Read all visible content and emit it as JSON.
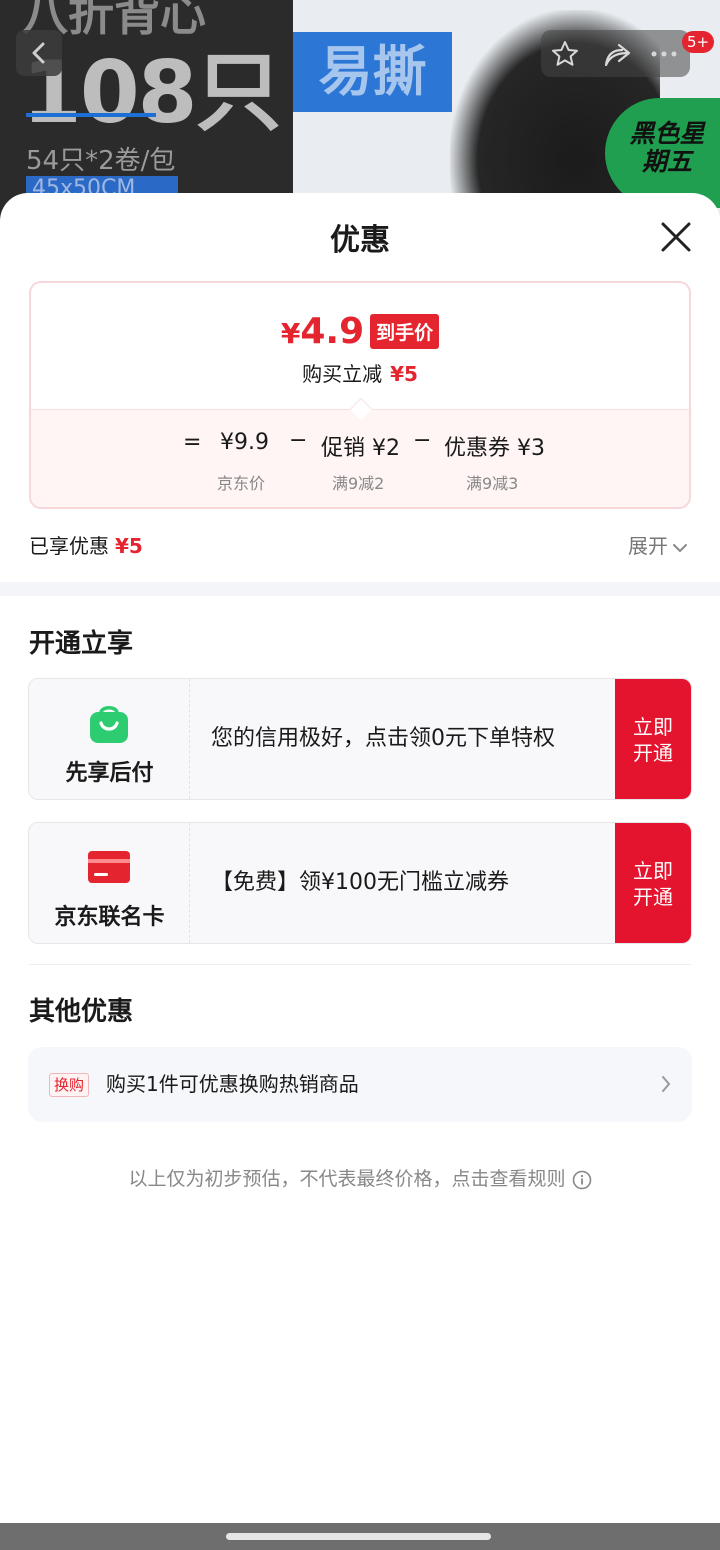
{
  "banner": {
    "headline": "八折背心",
    "count": "108只",
    "spec": "54只*2卷/包",
    "size": "45x50CM",
    "tag": "易撕",
    "promo": "黑色星期五",
    "cart_badge": "5+"
  },
  "sheet": {
    "title": "优惠",
    "final_price_symbol": "¥",
    "final_price": "4.9",
    "final_price_tag": "到手价",
    "instant_cut_label": "购买立减",
    "instant_cut_value": "¥5",
    "formula": {
      "equals": "=",
      "base_price": "¥9.9",
      "base_price_label": "京东价",
      "minus1": "−",
      "promo": "促销 ¥2",
      "promo_label": "满9减2",
      "minus2": "−",
      "coupon": "优惠券 ¥3",
      "coupon_label": "满9减3"
    },
    "enjoyed_label": "已享优惠",
    "enjoyed_value": "¥5",
    "expand_label": "展开"
  },
  "open_section": {
    "title": "开通立享",
    "offers": [
      {
        "name": "先享后付",
        "icon": "shopping-bag-icon",
        "text": "您的信用极好，点击领0元下单特权",
        "button": "立即\n开通"
      },
      {
        "name": "京东联名卡",
        "icon": "credit-card-icon",
        "text": "【免费】领¥100无门槛立减券",
        "button": "立即\n开通"
      }
    ]
  },
  "other_section": {
    "title": "其他优惠",
    "tag": "换购",
    "text": "购买1件可优惠换购热销商品"
  },
  "footnote": "以上仅为初步预估，不代表最终价格，点击查看规则",
  "colors": {
    "accent": "#e4242e",
    "green": "#2ecc71"
  }
}
